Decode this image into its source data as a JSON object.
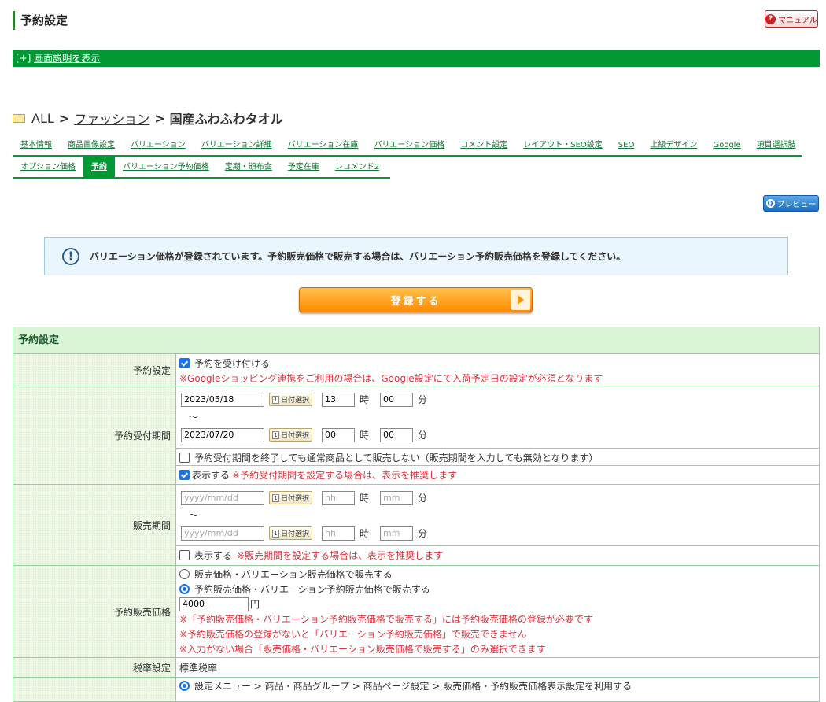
{
  "header": {
    "title": "予約設定",
    "manual_label": "マニュアル"
  },
  "explain": {
    "prefix": "[+]",
    "link": "画面説明を表示"
  },
  "breadcrumb": {
    "items": [
      "ALL",
      "ファッション"
    ],
    "current": "国産ふわふわタオル",
    "separator": ">"
  },
  "tabs": {
    "row1": [
      "基本情報",
      "商品画像設定",
      "バリエーション",
      "バリエーション詳細",
      "バリエーション在庫",
      "バリエーション価格",
      "コメント設定",
      "レイアウト・SEO設定",
      "SEO",
      "上級デザイン",
      "Google",
      "項目選択肢"
    ],
    "row2": [
      "オプション価格",
      "予約",
      "バリエーション予約価格",
      "定期・頒布会",
      "予定在庫",
      "レコメンド2"
    ],
    "active": "予約"
  },
  "preview_label": "プレビュー",
  "notice": {
    "icon": "info-circle-icon",
    "text": "バリエーション価格が登録されています。予約販売価格で販売する場合は、バリエーション予約販売価格を登録してください。"
  },
  "register_label": "登録する",
  "form": {
    "section_title": "予約設定",
    "reservation": {
      "label": "予約設定",
      "checkbox_label": "予約を受け付ける",
      "checked": true,
      "note": "※Googleショッピング連携をご利用の場合は、Google設定にて入荷予定日の設定が必須となります"
    },
    "acceptance_period": {
      "label": "予約受付期間",
      "start": {
        "date": "2023/05/18",
        "hour": "13",
        "minute": "00"
      },
      "end": {
        "date": "2023/07/20",
        "hour": "00",
        "minute": "00"
      },
      "date_button": "日付選択",
      "hour_unit": "時",
      "minute_unit": "分",
      "tilde": "～",
      "no_normal_sale_label": "予約受付期間を終了しても通常商品として販売しない（販売期間を入力しても無効となります）",
      "no_normal_sale_checked": false,
      "display_label": "表示する",
      "display_checked": true,
      "display_note": "※予約受付期間を設定する場合は、表示を推奨します"
    },
    "sales_period": {
      "label": "販売期間",
      "date_placeholder": "yyyy/mm/dd",
      "hour_placeholder": "hh",
      "minute_placeholder": "mm",
      "display_label": "表示する",
      "display_checked": false,
      "display_note": "※販売期間を設定する場合は、表示を推奨します"
    },
    "reservation_price": {
      "label": "予約販売価格",
      "option1": "販売価格・バリエーション販売価格で販売する",
      "option2": "予約販売価格・バリエーション予約販売価格で販売する",
      "selected": 2,
      "price": "4000",
      "unit": "円",
      "notes": [
        "※「予約販売価格・バリエーション予約販売価格で販売する」には予約販売価格の登録が必要です",
        "※予約販売価格の登録がないと「バリエーション予約販売価格」で販売できません",
        "※入力がない場合「販売価格・バリエーション販売価格で販売する」のみ選択できます"
      ]
    },
    "tax": {
      "label": "税率設定",
      "value": "標準税率"
    },
    "display_setting": {
      "option1": "設定メニュー > 商品・商品グループ > 商品ページ設定 > 販売価格・予約販売価格表示設定を利用する"
    }
  }
}
